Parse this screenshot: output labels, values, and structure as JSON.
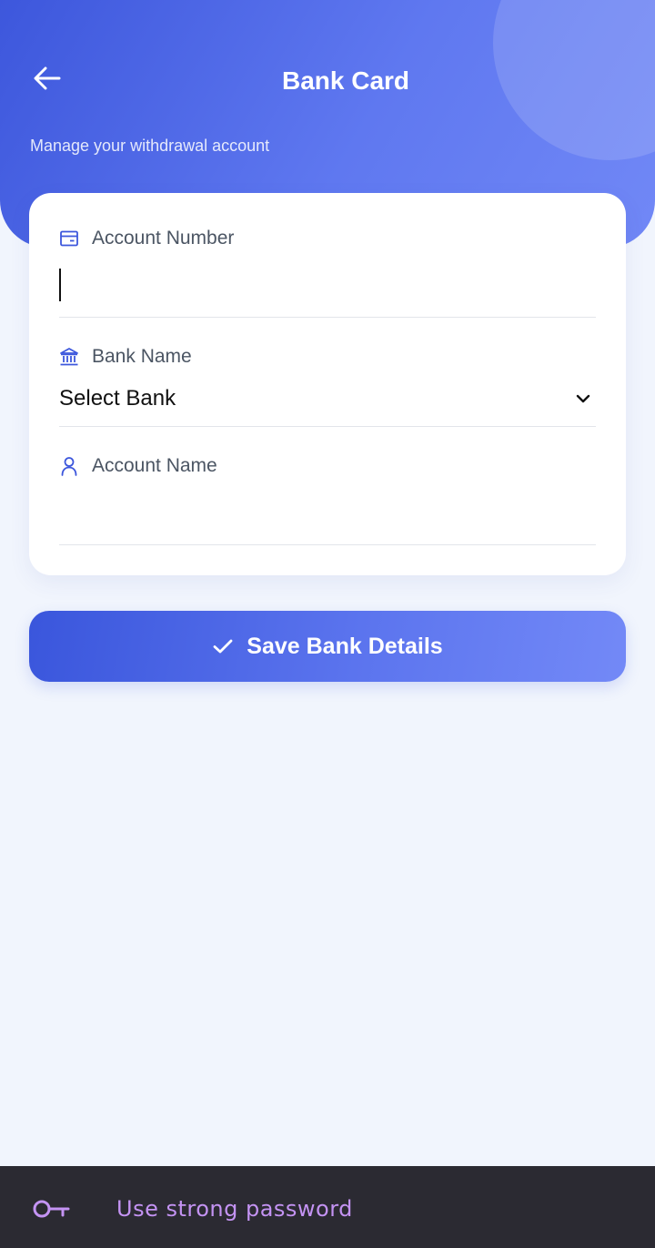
{
  "header": {
    "title": "Bank Card",
    "subtitle": "Manage your withdrawal account",
    "back_icon": "arrow-left-icon"
  },
  "form": {
    "account_number": {
      "label": "Account Number",
      "icon": "card-icon",
      "value": ""
    },
    "bank_name": {
      "label": "Bank Name",
      "icon": "bank-icon",
      "selected": "Select Bank",
      "dropdown_icon": "chevron-down-icon"
    },
    "account_name": {
      "label": "Account Name",
      "icon": "person-icon",
      "value": ""
    }
  },
  "save_button": {
    "label": "Save Bank Details",
    "icon": "check-icon"
  },
  "tip": {
    "text": "Use strong password",
    "icon": "key-icon"
  },
  "colors": {
    "primary": "#3d57dc",
    "primary_light": "#7389f7",
    "background": "#f1f5fd",
    "tip_background": "#2b2a32",
    "tip_text": "#c493f3"
  }
}
